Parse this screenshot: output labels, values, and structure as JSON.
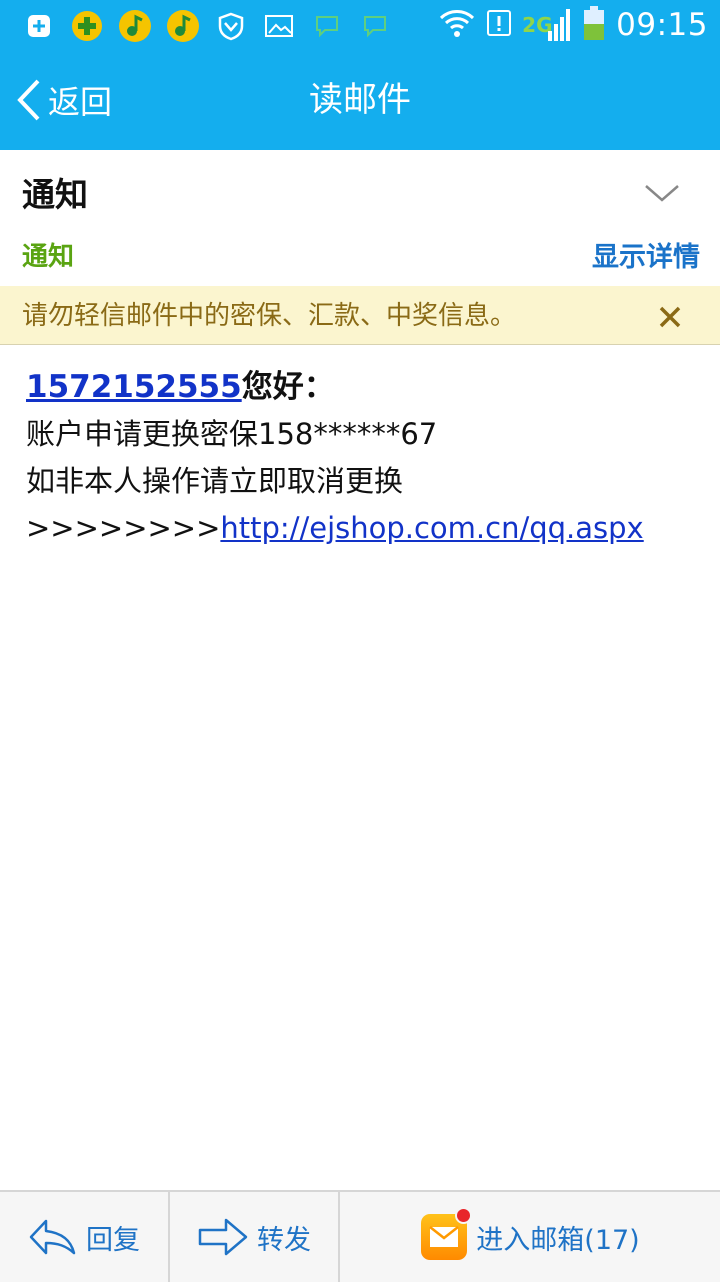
{
  "status_bar": {
    "time": "09:15",
    "network": "2G",
    "left_icons": [
      "plus-square-icon",
      "qq-security-icon",
      "qq-music-icon",
      "qq-music-icon",
      "shield-icon",
      "image-icon",
      "chat-bubble-icon",
      "chat-bubble-icon"
    ],
    "right_icons": [
      "wifi-icon",
      "alert-icon",
      "signal-icon",
      "battery-icon"
    ]
  },
  "header": {
    "back_label": "返回",
    "title": "读邮件"
  },
  "mail": {
    "subject": "通知",
    "sender": "通知",
    "show_details": "显示详情"
  },
  "banner": {
    "text": "请勿轻信邮件中的密保、汇款、中奖信息。"
  },
  "body": {
    "greeting_link": "1572152555",
    "greeting_tail": "您好：",
    "line2": "账户申请更换密保158******67",
    "line3": "如非本人操作请立即取消更换",
    "line4_prefix": ">>>>>>>>",
    "line4_link": "http://ejshop.com.cn/qq.aspx"
  },
  "bottom_bar": {
    "reply_label": "回复",
    "forward_label": "转发",
    "inbox_label": "进入邮箱(17)"
  },
  "colors": {
    "header_bg": "#14aeee",
    "sender_green": "#5aa412",
    "detail_blue": "#1a73c9",
    "banner_bg": "#fbf5cf",
    "link_blue": "#1233c8"
  }
}
